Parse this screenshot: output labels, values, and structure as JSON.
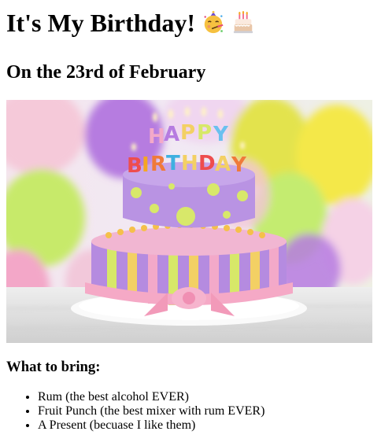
{
  "header": {
    "title": "It's My Birthday!",
    "title_icons": [
      "partying-face-icon",
      "birthday-cake-icon"
    ]
  },
  "subtitle": "On the 23rd of February",
  "image": {
    "caption": "",
    "cake_letters_top": [
      "H",
      "A",
      "P",
      "P",
      "Y"
    ],
    "cake_letters_bottom": [
      "B",
      "I",
      "R",
      "T",
      "H",
      "D",
      "A",
      "Y"
    ]
  },
  "section": {
    "heading": "What to bring:",
    "items": [
      "Rum (the best alcohol EVER)",
      "Fruit Punch (the best mixer with rum EVER)",
      "A Present (becuase I like them)"
    ]
  }
}
